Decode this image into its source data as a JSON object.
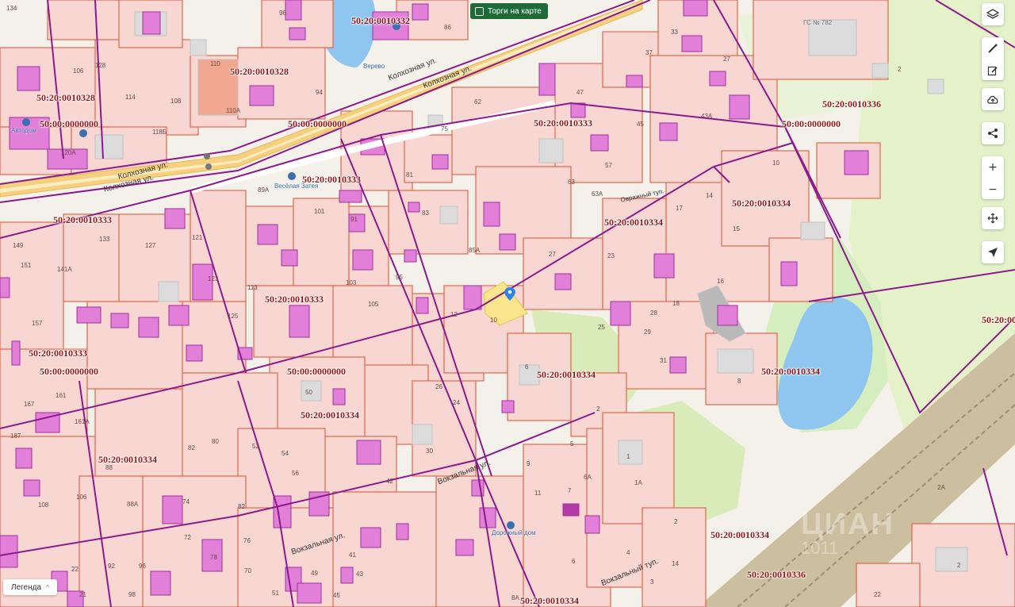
{
  "map": {
    "cadastral_labels": [
      "50:20:0010332",
      "50:20:0010328",
      "50:20:0010328",
      "50:00:0000000",
      "50:00:0000000",
      "50:20:0010333",
      "50:20:0010333",
      "50:00:0000000",
      "50:20:0010336",
      "50:20:0010334",
      "50:20:0010334",
      "50:20:0010333",
      "50:20:0010333",
      "50:20:0010333",
      "50:00:0000000",
      "50:00:0000000",
      "50:20:0010334",
      "50:20:0010334",
      "50:20:0010334",
      "50:20:0010334",
      "50:20:0010334",
      "50:20:0010336",
      "50:20:0010334",
      "50:20:0010"
    ],
    "plot_numbers": [
      "134",
      "96",
      "86",
      "110",
      "128",
      "108",
      "110А",
      "114",
      "118Б",
      "120А",
      "94",
      "106",
      "75",
      "62",
      "47",
      "33",
      "37",
      "27",
      "43А",
      "2",
      "45",
      "57",
      "63",
      "63А",
      "10",
      "17",
      "14",
      "15",
      "16",
      "18",
      "23",
      "25",
      "28",
      "29",
      "31",
      "8",
      "27",
      "85А",
      "83",
      "81",
      "91",
      "101",
      "89А",
      "103",
      "105",
      "95",
      "113",
      "125",
      "121",
      "123",
      "127",
      "133",
      "149",
      "151",
      "141А",
      "157",
      "161",
      "161А",
      "167",
      "187",
      "82",
      "80",
      "52",
      "54",
      "56",
      "50",
      "26",
      "24",
      "30",
      "42",
      "12",
      "10",
      "6",
      "2",
      "9",
      "11",
      "5",
      "6А",
      "1",
      "1А",
      "2",
      "7",
      "4",
      "6",
      "8А",
      "14",
      "3",
      "2А",
      "2",
      "22",
      "41",
      "43",
      "45",
      "49",
      "51",
      "98",
      "96",
      "92",
      "88",
      "88А",
      "106",
      "108",
      "72",
      "74",
      "82",
      "76",
      "78",
      "70",
      "22",
      "21"
    ],
    "street_labels": [
      "Колхозная ул.",
      "Колхозная ул.",
      "Колхозная ул.",
      "Колхозная ул.",
      "Вокзальная ул.",
      "Вокзальная ул.",
      "Вокзальный туп.",
      "Овражный туп."
    ],
    "poi_labels": [
      "Магазин 24",
      "Автодом",
      "Весёлая Затея",
      "Дорожный дом",
      "Верево",
      "ГС № 782"
    ],
    "watermark": "ЦИАН",
    "watermark_sub": "1011"
  },
  "controls": {
    "torgi_label": "Торги на карте",
    "legend_label": "Легенда",
    "legend_chevron": "^",
    "layers_icon": "layers-icon",
    "ruler_icon": "ruler-icon",
    "edit_icon": "edit-icon",
    "upload_icon": "cloud-upload-icon",
    "share_icon": "share-icon",
    "zoom_in": "+",
    "zoom_out": "−",
    "move_icon": "move-icon",
    "locate_icon": "locate-icon"
  },
  "colors": {
    "parcel_fill": "#f8d6d1",
    "parcel_stroke": "#e0502e",
    "block_stroke": "#8b1a8b",
    "building": "#e27fd8",
    "road": "#f5d07f",
    "water": "#8ec6f0",
    "green": "#d9ebc0",
    "selected": "#f8e58c",
    "pin": "#2a86e6"
  }
}
